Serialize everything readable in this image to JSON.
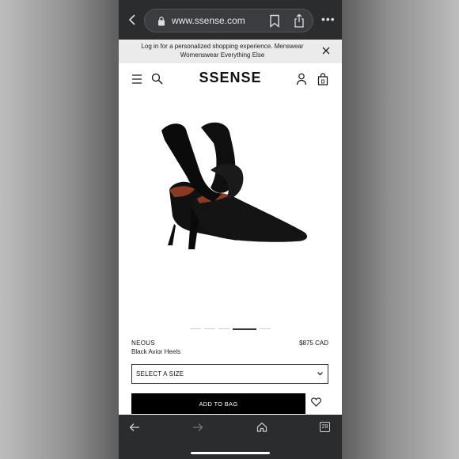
{
  "browser": {
    "url": "www.ssense.com",
    "tab_count": "29"
  },
  "banner": {
    "text": "Log in for a personalized shopping experience. Menswear Womenswear Everything Else"
  },
  "site": {
    "logo": "SSENSE"
  },
  "product": {
    "brand": "NEOUS",
    "name": "Black Avior Heels",
    "price": "$875 CAD",
    "image_count": 5,
    "active_image": 4
  },
  "actions": {
    "size_select_label": "SELECT A SIZE",
    "add_to_bag_label": "ADD TO BAG"
  },
  "icons": [
    "back-chevron-icon",
    "lock-icon",
    "bookmark-icon",
    "share-icon",
    "more-icon",
    "close-icon",
    "menu-icon",
    "search-icon",
    "account-icon",
    "bag-icon",
    "chevron-down-icon",
    "heart-icon",
    "back-arrow-icon",
    "forward-arrow-icon",
    "home-icon",
    "tabs-icon"
  ]
}
